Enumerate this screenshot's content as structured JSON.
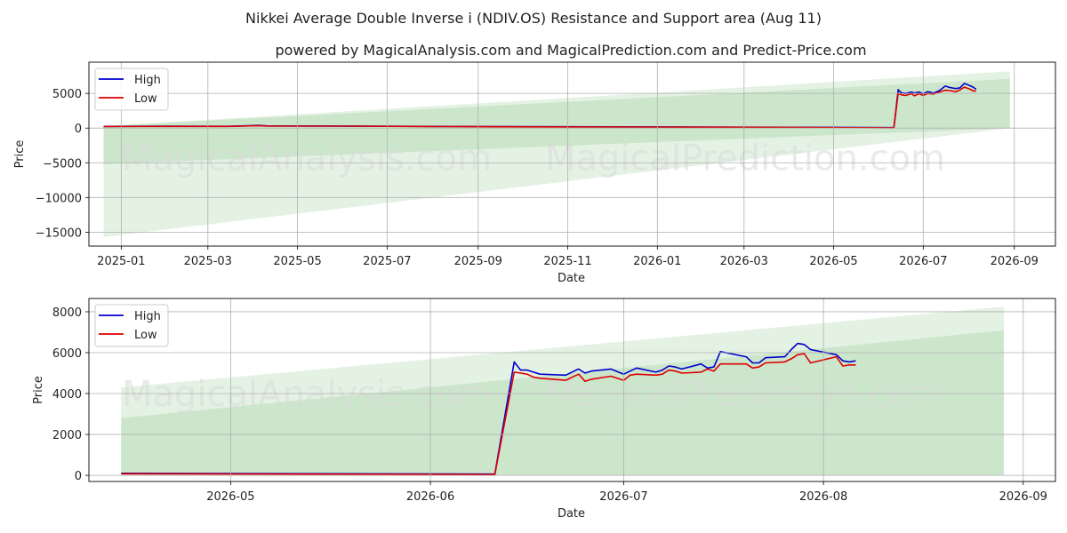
{
  "title": "Nikkei Average Double Inverse i (NDIV.OS) Resistance and Support area (Aug 11)",
  "subtitle": "powered by MagicalAnalysis.com and MagicalPrediction.com and Predict-Price.com",
  "watermark_left": "MagicalAnalysis.com",
  "watermark_right": "MagicalPrediction.com",
  "colors": {
    "high": "#0000cc",
    "low": "#dd0000",
    "band": "#2e9e2e",
    "grid": "#b0b0b0"
  },
  "chart_data": [
    {
      "type": "line",
      "xlabel": "Date",
      "ylabel": "Price",
      "x_tick_labels": [
        "2025-01",
        "2025-03",
        "2025-05",
        "2025-07",
        "2025-09",
        "2025-11",
        "2026-01",
        "2026-03",
        "2026-05",
        "2026-07",
        "2026-09"
      ],
      "y_tick_labels": [
        "5000",
        "0",
        "−5000",
        "−10000",
        "−15000"
      ],
      "xlim": [
        "2024-12-10",
        "2026-09-29"
      ],
      "ylim": [
        -17000,
        9500
      ],
      "grid": true,
      "legend": "upper left",
      "series": [
        {
          "name": "High",
          "x": [
            "2024-12-20",
            "2025-02-01",
            "2025-03-15",
            "2025-04-05",
            "2025-04-10",
            "2025-06-01",
            "2025-08-01",
            "2025-10-01",
            "2025-12-01",
            "2026-02-01",
            "2026-04-14",
            "2026-06-11",
            "2026-06-14",
            "2026-06-16",
            "2026-06-19",
            "2026-06-23",
            "2026-06-25",
            "2026-06-28",
            "2026-07-01",
            "2026-07-04",
            "2026-07-08",
            "2026-07-12",
            "2026-07-16",
            "2026-07-19",
            "2026-07-23",
            "2026-07-26",
            "2026-07-29",
            "2026-08-02",
            "2026-08-04",
            "2026-08-06"
          ],
          "values": [
            250,
            270,
            260,
            380,
            320,
            300,
            250,
            200,
            180,
            150,
            110,
            60,
            5550,
            5100,
            5000,
            5200,
            5050,
            5200,
            4950,
            5250,
            5050,
            5400,
            6050,
            5850,
            5700,
            5800,
            6450,
            6100,
            5900,
            5600
          ]
        },
        {
          "name": "Low",
          "x": [
            "2024-12-20",
            "2025-02-01",
            "2025-03-15",
            "2025-04-05",
            "2025-04-10",
            "2025-06-01",
            "2025-08-01",
            "2025-10-01",
            "2025-12-01",
            "2026-02-01",
            "2026-04-14",
            "2026-06-11",
            "2026-06-14",
            "2026-06-16",
            "2026-06-19",
            "2026-06-23",
            "2026-06-25",
            "2026-06-28",
            "2026-07-01",
            "2026-07-04",
            "2026-07-08",
            "2026-07-12",
            "2026-07-16",
            "2026-07-19",
            "2026-07-23",
            "2026-07-26",
            "2026-07-29",
            "2026-08-02",
            "2026-08-04",
            "2026-08-06"
          ],
          "values": [
            230,
            250,
            240,
            350,
            300,
            280,
            230,
            180,
            160,
            130,
            90,
            40,
            5050,
            4800,
            4700,
            4950,
            4650,
            4950,
            4700,
            5000,
            4900,
            5200,
            5450,
            5400,
            5250,
            5500,
            5900,
            5600,
            5350,
            5350
          ]
        }
      ],
      "bands": [
        {
          "x": [
            "2024-12-20",
            "2026-08-29"
          ],
          "upper": [
            300,
            8200
          ],
          "lower": [
            -15700,
            0
          ]
        },
        {
          "x": [
            "2024-12-20",
            "2026-08-29"
          ],
          "upper": [
            300,
            7100
          ],
          "lower": [
            -5200,
            0
          ]
        }
      ]
    },
    {
      "type": "line",
      "xlabel": "Date",
      "ylabel": "Price",
      "x_tick_labels": [
        "2026-05",
        "2026-06",
        "2026-07",
        "2026-08",
        "2026-09"
      ],
      "y_tick_labels": [
        "8000",
        "6000",
        "4000",
        "2000",
        "0"
      ],
      "xlim": [
        "2026-04-09",
        "2026-09-06"
      ],
      "ylim": [
        -300,
        8650
      ],
      "grid": true,
      "legend": "upper left",
      "series": [
        {
          "name": "High",
          "x": [
            "2026-04-14",
            "2026-06-11",
            "2026-06-14",
            "2026-06-15",
            "2026-06-16",
            "2026-06-17",
            "2026-06-18",
            "2026-06-22",
            "2026-06-24",
            "2026-06-25",
            "2026-06-26",
            "2026-06-29",
            "2026-07-01",
            "2026-07-02",
            "2026-07-03",
            "2026-07-06",
            "2026-07-07",
            "2026-07-08",
            "2026-07-09",
            "2026-07-10",
            "2026-07-13",
            "2026-07-14",
            "2026-07-15",
            "2026-07-16",
            "2026-07-20",
            "2026-07-21",
            "2026-07-22",
            "2026-07-23",
            "2026-07-26",
            "2026-07-27",
            "2026-07-28",
            "2026-07-29",
            "2026-07-30",
            "2026-08-03",
            "2026-08-04",
            "2026-08-05",
            "2026-08-06"
          ],
          "values": [
            100,
            60,
            5550,
            5150,
            5150,
            5050,
            4950,
            4900,
            5200,
            5000,
            5100,
            5200,
            4950,
            5100,
            5250,
            5050,
            5150,
            5350,
            5300,
            5200,
            5450,
            5250,
            5300,
            6050,
            5800,
            5500,
            5500,
            5750,
            5800,
            6150,
            6450,
            6400,
            6150,
            5900,
            5600,
            5550,
            5600
          ]
        },
        {
          "name": "Low",
          "x": [
            "2026-04-14",
            "2026-06-11",
            "2026-06-14",
            "2026-06-15",
            "2026-06-16",
            "2026-06-17",
            "2026-06-18",
            "2026-06-22",
            "2026-06-24",
            "2026-06-25",
            "2026-06-26",
            "2026-06-29",
            "2026-07-01",
            "2026-07-02",
            "2026-07-03",
            "2026-07-06",
            "2026-07-07",
            "2026-07-08",
            "2026-07-09",
            "2026-07-10",
            "2026-07-13",
            "2026-07-14",
            "2026-07-15",
            "2026-07-16",
            "2026-07-20",
            "2026-07-21",
            "2026-07-22",
            "2026-07-23",
            "2026-07-26",
            "2026-07-27",
            "2026-07-28",
            "2026-07-29",
            "2026-07-30",
            "2026-08-03",
            "2026-08-04",
            "2026-08-05",
            "2026-08-06"
          ],
          "values": [
            80,
            40,
            5050,
            5000,
            4950,
            4800,
            4750,
            4650,
            4950,
            4600,
            4700,
            4850,
            4650,
            4900,
            4950,
            4900,
            4950,
            5150,
            5100,
            5000,
            5050,
            5200,
            5100,
            5450,
            5450,
            5250,
            5300,
            5500,
            5550,
            5700,
            5900,
            5950,
            5500,
            5800,
            5350,
            5400,
            5400
          ]
        }
      ],
      "bands": [
        {
          "x": [
            "2026-04-14",
            "2026-08-29"
          ],
          "upper": [
            4300,
            8250
          ],
          "lower": [
            0,
            0
          ]
        },
        {
          "x": [
            "2026-04-14",
            "2026-08-29"
          ],
          "upper": [
            2800,
            7100
          ],
          "lower": [
            0,
            0
          ]
        }
      ]
    }
  ]
}
